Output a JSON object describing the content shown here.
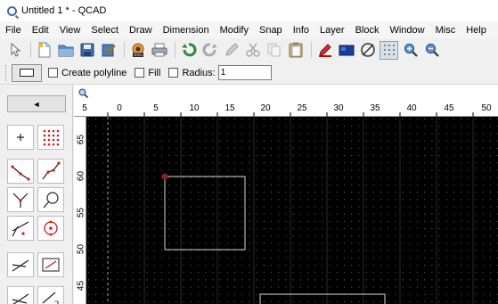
{
  "window": {
    "title": "Untitled 1 * - QCAD",
    "app_icon": "qcad-logo-icon"
  },
  "menubar": {
    "items": [
      "File",
      "Edit",
      "View",
      "Select",
      "Draw",
      "Dimension",
      "Modify",
      "Snap",
      "Info",
      "Layer",
      "Block",
      "Window",
      "Misc",
      "Help"
    ]
  },
  "toolbar": {
    "buttons": [
      "pointer-icon",
      "new-file-icon",
      "open-folder-icon",
      "save-icon",
      "edit-icon",
      "svg-export-icon",
      "print-icon",
      "undo-icon",
      "redo-icon",
      "pencil-icon",
      "cut-icon",
      "copy-icon",
      "paste-icon",
      "pen-color-icon",
      "fill-color-icon",
      "no-fill-icon",
      "grid-icon",
      "zoom-in-icon",
      "zoom-out-icon"
    ]
  },
  "options": {
    "create_polyline_label": "Create polyline",
    "fill_label": "Fill",
    "radius_label": "Radius:",
    "radius_value": "1"
  },
  "toolpanel": {
    "back_label": "◄",
    "tools": [
      "crosshair-tool-icon",
      "point-grid-tool-icon",
      "line-from-point-icon",
      "line-segments-icon",
      "line-angle-icon",
      "circle-tangent-icon",
      "line-parallel-icon",
      "circle-target-icon",
      "line-perpendicular-icon",
      "rectangle-line-icon",
      "line-bisector-icon",
      "line-relative-icon"
    ]
  },
  "ruler": {
    "horizontal_labels": [
      "5",
      "0",
      "5",
      "10",
      "15",
      "20",
      "25",
      "30",
      "35",
      "40",
      "45",
      "50"
    ],
    "vertical_labels": [
      "65",
      "60",
      "55",
      "50",
      "45"
    ]
  },
  "canvas": {
    "background": "#000000",
    "grid_color": "#6b6b6b",
    "axis_color": "#c8a060",
    "entity_color": "#d9d9d9",
    "marker_color": "#8b2020"
  }
}
